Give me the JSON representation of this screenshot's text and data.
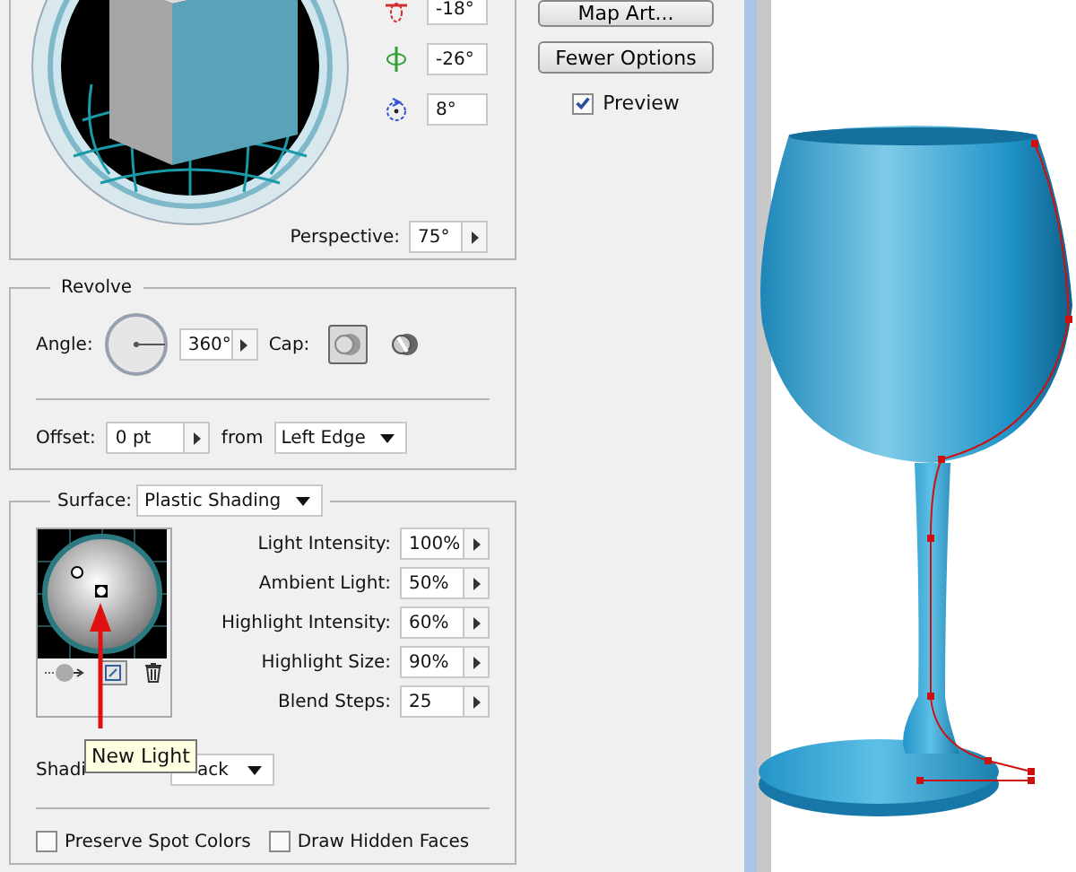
{
  "buttons": [
    {
      "label": "Map Art..."
    },
    {
      "label": "Fewer Options"
    }
  ],
  "preview": {
    "label": "Preview",
    "checked": true
  },
  "rotation": {
    "fields": [
      {
        "kind": "x",
        "value": "-18°"
      },
      {
        "kind": "y",
        "value": "-26°"
      },
      {
        "kind": "z",
        "value": "8°"
      }
    ],
    "perspective": {
      "label": "Perspective:",
      "value": "75°"
    }
  },
  "revolve": {
    "title": "Revolve",
    "angle": {
      "label": "Angle:",
      "value": "360°"
    },
    "cap": {
      "label": "Cap:",
      "options": [
        {
          "kind": "on",
          "selected": true
        },
        {
          "kind": "off",
          "selected": false
        }
      ]
    },
    "offset": {
      "label": "Offset:",
      "value": "0 pt",
      "from_label": "from",
      "from_value": "Left Edge"
    }
  },
  "surface": {
    "label": "Surface:",
    "value": "Plastic Shading",
    "settings": [
      {
        "label": "Light Intensity:",
        "value": "100%"
      },
      {
        "label": "Ambient Light:",
        "value": "50%"
      },
      {
        "label": "Highlight Intensity:",
        "value": "60%"
      },
      {
        "label": "Highlight Size:",
        "value": "90%"
      },
      {
        "label": "Blend Steps:",
        "value": "25"
      }
    ],
    "shading": {
      "label": "Shadi",
      "value": "ack"
    },
    "tooltip": "New Light",
    "options": [
      {
        "label": "Preserve Spot Colors",
        "checked": false
      },
      {
        "label": "Draw Hidden Faces",
        "checked": false
      }
    ]
  }
}
